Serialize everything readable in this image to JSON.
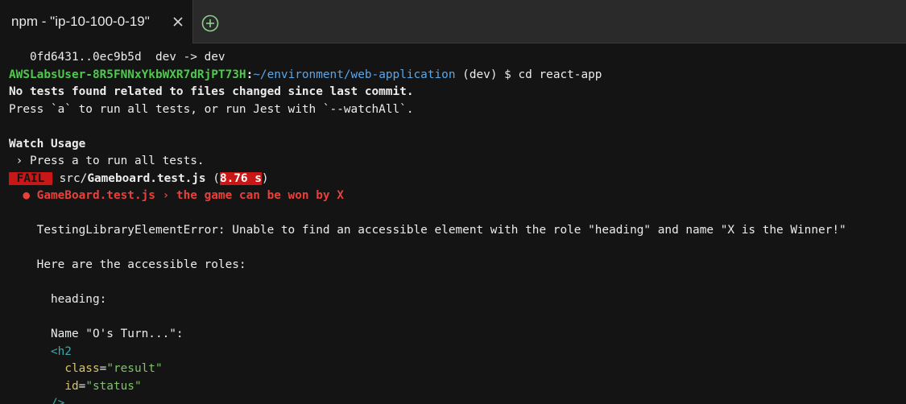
{
  "tab": {
    "title": "npm - \"ip-10-100-0-19\"",
    "close_icon": "close-icon",
    "new_tab_icon": "add-circle-icon"
  },
  "colors": {
    "prompt_user": "#4ec94e",
    "prompt_path": "#5aa7e8",
    "fail": "#c91616",
    "error_title": "#e8403c",
    "tag": "#3aa9a4",
    "attr": "#d9c36a",
    "attr_value": "#7fc36a"
  },
  "terminal": {
    "cut_line": "    ·    ·  ·                         ·  ·  ·  ·     ·",
    "git_line": "   0fd6431..0ec9b5d  dev -> dev",
    "prompt": {
      "user": "AWSLabsUser-8R5FNNxYkbWXR7dRjPT73H",
      "sep": ":",
      "path": "~/environment/web-application",
      "branch": " (dev) $ ",
      "command": "cd react-app"
    },
    "no_tests": "No tests found related to files changed since last commit.",
    "press_hint": "Press `a` to run all tests, or run Jest with `--watchAll`.",
    "watch_usage": "Watch Usage",
    "watch_item": " › Press a to run all tests.",
    "fail_label": " FAIL ",
    "test_file_dir": " src/",
    "test_file_name": "Gameboard.test.js",
    "time_open": " (",
    "time": "8.76 s",
    "time_close": ")",
    "test_error_title": "  ● GameBoard.test.js › the game can be won by X",
    "error_message": "    TestingLibraryElementError: Unable to find an accessible element with the role \"heading\" and name \"X is the Winner!\"",
    "roles_intro": "    Here are the accessible roles:",
    "role_heading": "      heading:",
    "role_name": "      Name \"O's Turn...\":",
    "tag_open": "      <h2",
    "attr_class_indent": "        ",
    "attr_class_name": "class",
    "attr_class_eq": "=",
    "attr_class_value": "\"result\"",
    "attr_id_indent": "        ",
    "attr_id_name": "id",
    "attr_id_eq": "=",
    "attr_id_value": "\"status\"",
    "tag_close": "      />"
  }
}
